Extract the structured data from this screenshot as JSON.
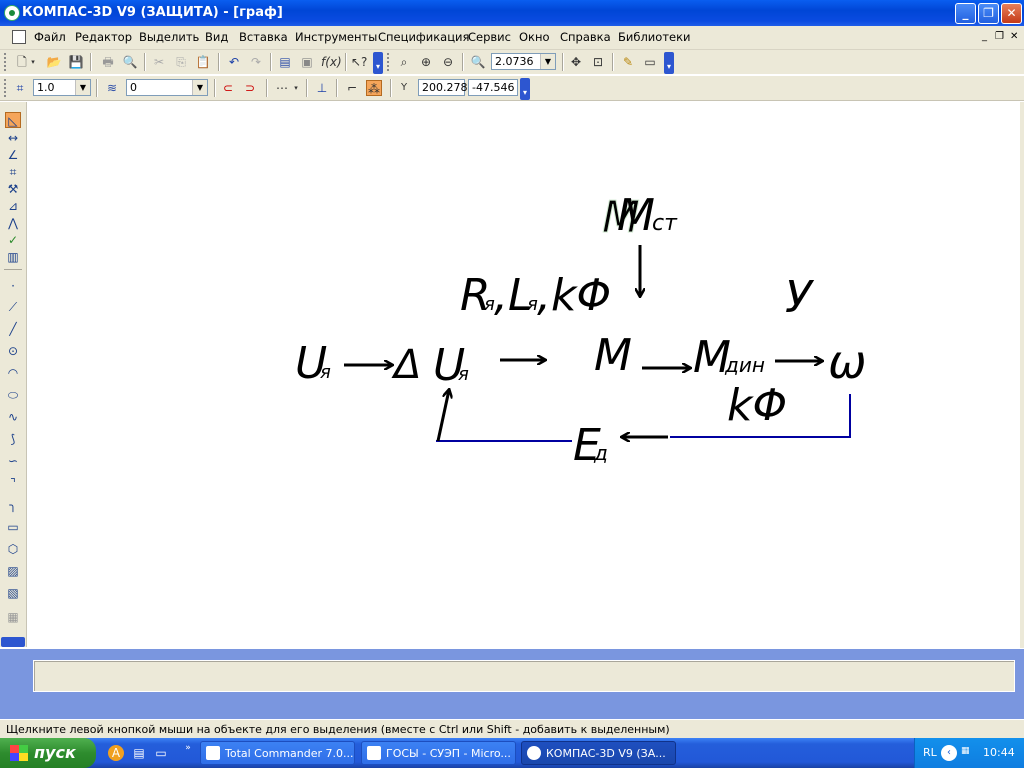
{
  "window": {
    "title": "КОМПАС-3D V9 (ЗАЩИТА) - [граф]",
    "buttons": {
      "minimize": "_",
      "maximize": "❐",
      "close": "✕"
    }
  },
  "menu": {
    "items": [
      "Файл",
      "Редактор",
      "Выделить",
      "Вид",
      "Вставка",
      "Инструменты",
      "Спецификация",
      "Сервис",
      "Окно",
      "Справка",
      "Библиотеки"
    ],
    "mdi_controls": [
      "_",
      "❐",
      "✕"
    ]
  },
  "toolbar": {
    "zoom_value": "2.0736",
    "line_scale_value": "1.0",
    "layer_value": "0",
    "coord_label": "Y",
    "coord_x": "200.278",
    "coord_y": "-47.546"
  },
  "diagram": {
    "terms": {
      "u_ya": "U",
      "u_ya_sub": "я",
      "delta": "Δ",
      "delta_u": "U",
      "delta_u_sub": "я",
      "params": "R",
      "params_r_sub": "я",
      "params_l": ",L",
      "params_l_sub": "я",
      "params_kf": ",kΦ",
      "m": "M",
      "m_st": "M",
      "m_st_sub": "ст",
      "m_din": "M",
      "m_din_sub": "дин",
      "omega": "ω",
      "y": "У",
      "kf_feedback": "kΦ",
      "e_d": "E",
      "e_d_sub": "д"
    },
    "colors": {
      "ink": "#000000",
      "feedback_line": "#0000a0",
      "ghost": "#cfe8cf"
    }
  },
  "status": {
    "text": "Щелкните левой кнопкой мыши на объекте для его выделения (вместе с Ctrl или Shift - добавить к выделенным)"
  },
  "taskbar": {
    "start_label": "пуск",
    "tasks": [
      {
        "label": "Total Commander 7.0...",
        "active": false
      },
      {
        "label": "ГОСЫ - СУЭП - Micro...",
        "active": false
      },
      {
        "label": "КОМПАС-3D V9 (ЗА...",
        "active": true
      }
    ],
    "tray": {
      "lang": "RL",
      "clock": "10:44"
    }
  }
}
